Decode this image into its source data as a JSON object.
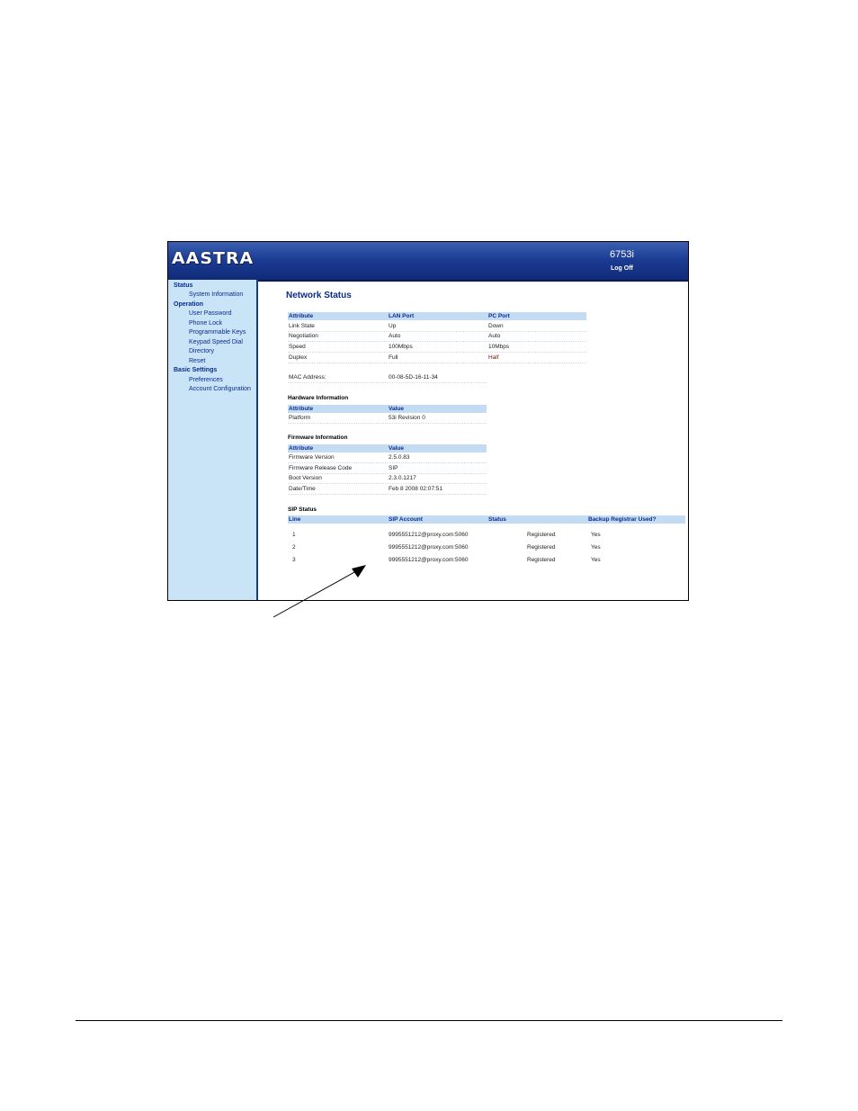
{
  "header": {
    "logo": "AASTRA",
    "model": "6753i",
    "logoff": "Log Off"
  },
  "sidebar": {
    "sections": [
      {
        "label": "Status",
        "items": [
          "System Information"
        ]
      },
      {
        "label": "Operation",
        "items": [
          "User Password",
          "Phone Lock",
          "Programmable Keys",
          "Keypad Speed Dial",
          "Directory",
          "Reset"
        ]
      },
      {
        "label": "Basic Settings",
        "items": [
          "Preferences",
          "Account Configuration"
        ]
      }
    ]
  },
  "main": {
    "title": "Network Status",
    "network": {
      "headers": [
        "Attribute",
        "LAN Port",
        "PC Port"
      ],
      "rows": [
        [
          "Link State",
          "Up",
          "Down"
        ],
        [
          "Negotiation",
          "Auto",
          "Auto"
        ],
        [
          "Speed",
          "100Mbps",
          "10Mbps"
        ],
        [
          "Duplex",
          "Full",
          "Half"
        ]
      ],
      "mac_label": "MAC Address:",
      "mac_value": "00-08-5D-16-11-34"
    },
    "hardware": {
      "title": "Hardware Information",
      "headers": [
        "Attribute",
        "Value"
      ],
      "rows": [
        [
          "Platform",
          "53i Revision 0"
        ]
      ]
    },
    "firmware": {
      "title": "Firmware Information",
      "headers": [
        "Attribute",
        "Value"
      ],
      "rows": [
        [
          "Firmware Version",
          "2.5.0.83"
        ],
        [
          "Firmware Release Code",
          "SIP"
        ],
        [
          "Boot Version",
          "2.3.0.1217"
        ],
        [
          "Date/Time",
          "Feb 8 2008 02:07:51"
        ]
      ]
    },
    "sip": {
      "title": "SIP Status",
      "headers": [
        "Line",
        "SIP Account",
        "Status",
        "Backup Registrar Used?"
      ],
      "rows": [
        [
          "1",
          "9995551212@proxy.com:5060",
          "Registered",
          "Yes"
        ],
        [
          "2",
          "9995551212@proxy.com:5060",
          "Registered",
          "Yes"
        ],
        [
          "3",
          "9995551212@proxy.com:5060",
          "Registered",
          "Yes"
        ]
      ]
    }
  }
}
